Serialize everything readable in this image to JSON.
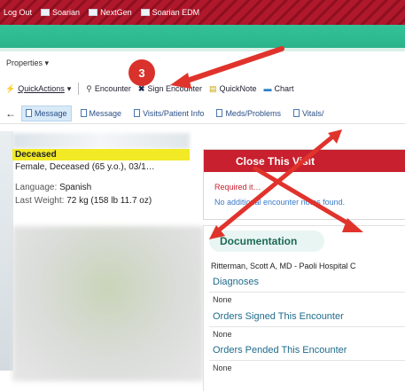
{
  "titlebar": {
    "items": [
      {
        "label": "Log Out",
        "icon": "logout-icon"
      },
      {
        "label": "Soarian",
        "icon": "app-window-icon"
      },
      {
        "label": "NextGen",
        "icon": "app-window-icon"
      },
      {
        "label": "Soarian EDM",
        "icon": "app-window-icon"
      }
    ]
  },
  "properties_label": "Properties",
  "toolbar": {
    "quick_actions": "QuickActions",
    "encounter": "Encounter",
    "sign_encounter": "Sign Encounter",
    "quicknote": "QuickNote",
    "chart": "Chart"
  },
  "tabs": [
    "Message",
    "Message",
    "Visits/Patient Info",
    "Meds/Problems",
    "Vitals/"
  ],
  "patient": {
    "status": "Deceased",
    "summary": "Female, Deceased (65 y.o.), 03/1…",
    "language_label": "Language:",
    "language_value": "Spanish",
    "weight_label": "Last Weight:",
    "weight_value": "72 kg (158 lb 11.7 oz)"
  },
  "close_visit": {
    "title": "Close This Visit",
    "required": "Required it…",
    "no_notes": "No additional encounter notes found."
  },
  "documentation": {
    "title": "Documentation",
    "provider": "Ritterman, Scott A, MD - Paoli Hospital C",
    "sections": [
      {
        "title": "Diagnoses",
        "value": "None"
      },
      {
        "title": "Orders Signed This Encounter",
        "value": "None"
      },
      {
        "title": "Orders Pended This Encounter",
        "value": "None"
      }
    ]
  },
  "annotation": {
    "badge": "3",
    "color": "#d9312b"
  },
  "colors": {
    "title_red": "#b0182c",
    "green_band": "#2bb48b",
    "close_visit_red": "#c8202e",
    "deceased_yellow": "#f2ea25"
  }
}
